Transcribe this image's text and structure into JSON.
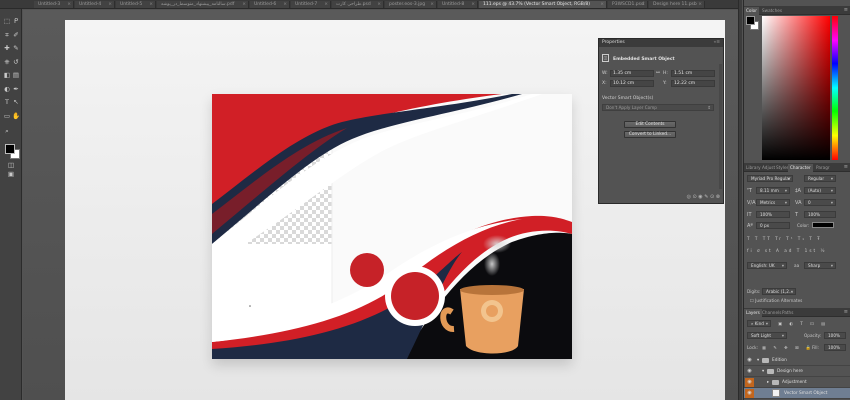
{
  "tabs": [
    {
      "label": "Untitled-3",
      "active": false
    },
    {
      "label": "Untitled-4",
      "active": false
    },
    {
      "label": "Untitled-5",
      "active": false
    },
    {
      "label": "سالنامه_پیشنهاد_متوسط_در_پوشه.pdf",
      "active": false
    },
    {
      "label": "Untitled-6",
      "active": false
    },
    {
      "label": "Untitled-7",
      "active": false
    },
    {
      "label": "طراحی کارت.psd",
      "active": false
    },
    {
      "label": "poster.eos-3.jpg",
      "active": false
    },
    {
      "label": "Untitled-8",
      "active": false
    },
    {
      "label": "111.eps @ 43.7% (Vector Smart Object, RGB/8)",
      "active": true
    },
    {
      "label": "P3WSCD1.psd",
      "active": false
    },
    {
      "label": "Design here 11.psb",
      "active": false
    }
  ],
  "tools": [
    "marquee-icon",
    "lasso-icon",
    "crop-icon",
    "eyedropper-icon",
    "healing-icon",
    "brush-icon",
    "stamp-icon",
    "history-brush-icon",
    "eraser-icon",
    "gradient-icon",
    "dodge-icon",
    "pen-icon",
    "type-icon",
    "path-select-icon",
    "rectangle-icon",
    "hand-icon",
    "zoom-icon",
    "quick-mask-icon",
    "screen-mode-icon"
  ],
  "properties": {
    "panel_title": "Properties",
    "object_title": "Embedded Smart Object",
    "w_label": "W:",
    "w_value": "1.35 cm",
    "h_label": "H:",
    "h_value": "1.51 cm",
    "x_label": "X:",
    "x_value": "10.12 cm",
    "y_label": "Y:",
    "y_value": "12.22 cm",
    "section_label": "Vector Smart Object(s)",
    "comp_dropdown": "Don't Apply Layer Comp",
    "edit_contents_label": "Edit Contents",
    "convert_label": "Convert to Linked..."
  },
  "color_panel": {
    "tabs": [
      "Color",
      "Swatches"
    ],
    "foreground": "#000000",
    "background": "#ffffff"
  },
  "character_panel": {
    "tabs": [
      "Library",
      "Adjust",
      "Styles",
      "Character",
      "Paragr"
    ],
    "font_family": "Myriad Pro Regular",
    "font_style": "Regular",
    "font_size": "8.11 mm",
    "leading": "(Auto)",
    "kerning": "Metrics",
    "tracking": "0",
    "vertical_scale": "100%",
    "horizontal_scale": "100%",
    "baseline": "0 px",
    "color_label": "Color:",
    "text_color": "#000000",
    "language": "English: UK",
    "anti_alias": "Sharp",
    "aa_icon": "aa",
    "digits_label": "Digits:",
    "digits_value": "Arabic (1,2...",
    "justification": "Justification Alternates"
  },
  "layers_panel": {
    "tabs": [
      "Layers",
      "Channels",
      "Paths"
    ],
    "filter": "Kind",
    "blend_mode": "Soft Light",
    "opacity_label": "Opacity:",
    "opacity_value": "100%",
    "lock_label": "Lock:",
    "fill_label": "Fill:",
    "fill_value": "100%",
    "layers": [
      {
        "name": "Edition",
        "type": "folder"
      },
      {
        "name": "Design here",
        "type": "folder"
      },
      {
        "name": "Adjustment",
        "type": "folder"
      },
      {
        "name": "Vector Smart Object",
        "type": "smart-object",
        "selected": true
      }
    ]
  },
  "colors": {
    "red": "#d11f26",
    "dark_red": "#9e1a1f",
    "navy": "#1e2a44",
    "mug": "#e8a060",
    "panel": "#535353"
  }
}
